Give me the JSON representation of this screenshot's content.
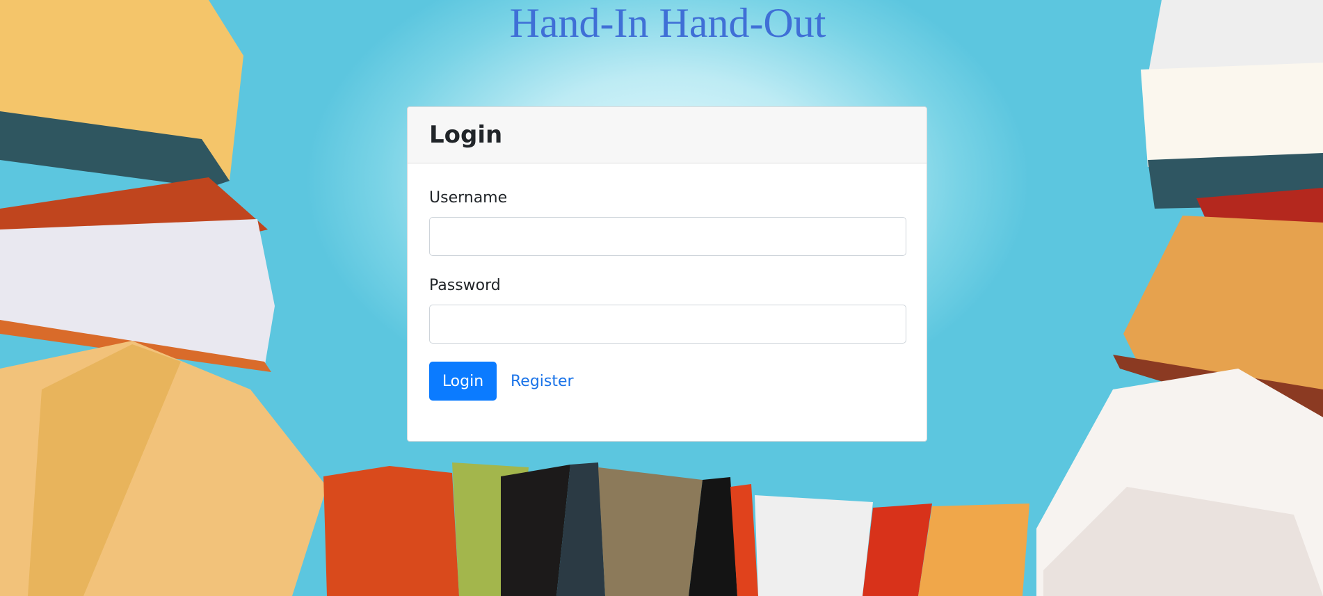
{
  "header": {
    "title": "Hand-In Hand-Out"
  },
  "login_card": {
    "title": "Login",
    "username_label": "Username",
    "username_value": "",
    "password_label": "Password",
    "password_value": "",
    "login_button": "Login",
    "register_link": "Register"
  },
  "background": {
    "icon": "books-photo"
  },
  "colors": {
    "title": "#3f6fd6",
    "primary_button": "#0b7bff",
    "link": "#1a73e8",
    "background_sky": "#5cc6df"
  }
}
